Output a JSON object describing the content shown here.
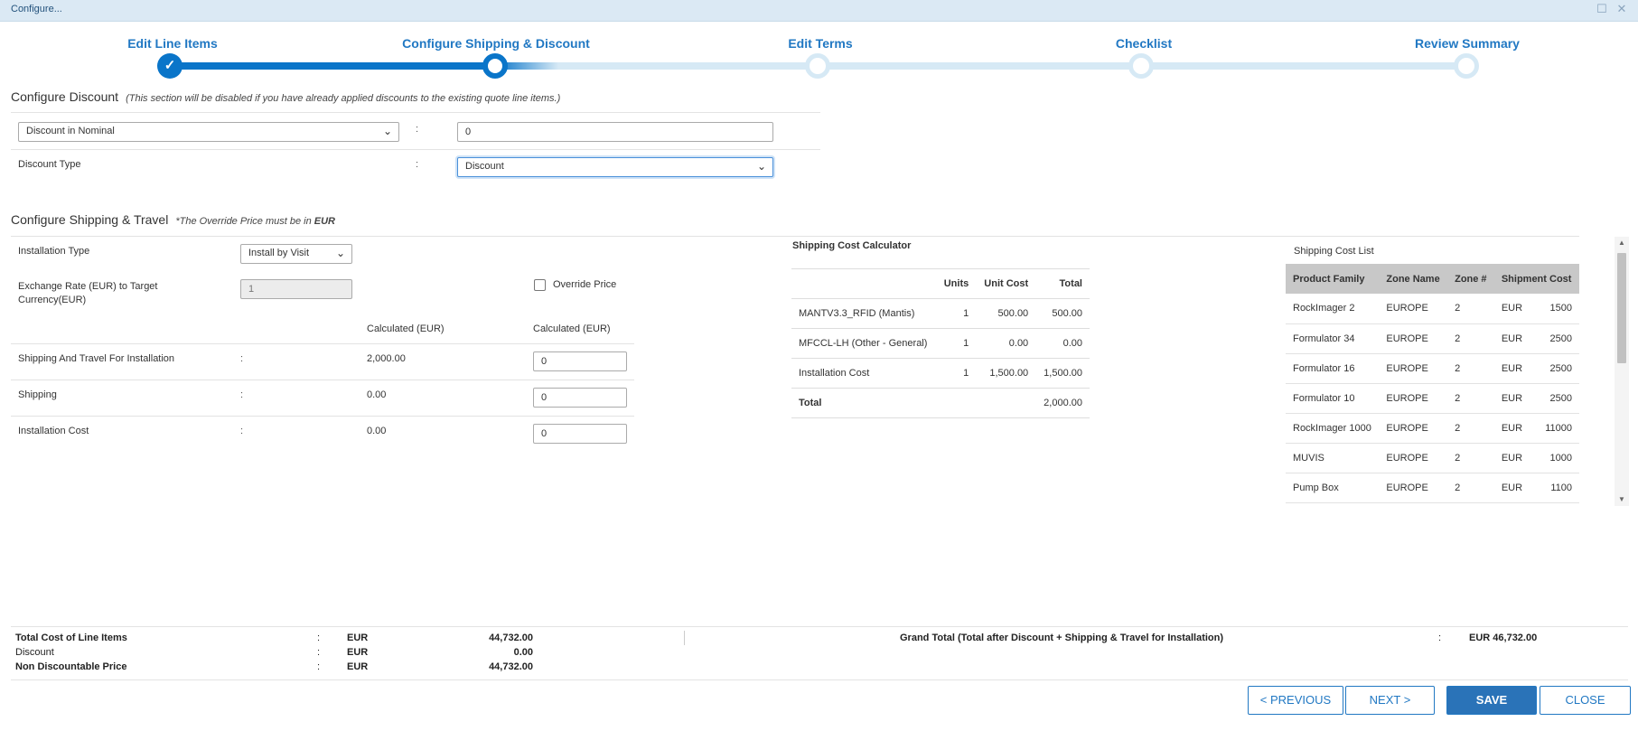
{
  "window": {
    "title": "Configure..."
  },
  "steps": [
    "Edit Line Items",
    "Configure Shipping & Discount",
    "Edit Terms",
    "Checklist",
    "Review Summary"
  ],
  "discount": {
    "title": "Configure Discount",
    "note": "(This section will be disabled if you have already applied discounts to the existing quote line items.)",
    "mode_value": "Discount in Nominal",
    "amount_value": "0",
    "type_label": "Discount Type",
    "type_value": "Discount"
  },
  "shipping": {
    "title": "Configure Shipping & Travel",
    "note_prefix": "*The Override Price must be in ",
    "note_currency": "EUR",
    "install_type_label": "Installation Type",
    "install_type_value": "Install by Visit",
    "exchange_label": "Exchange Rate (EUR) to Target Currency(EUR)",
    "exchange_value": "1",
    "override_label": "Override Price",
    "col1": "Calculated (EUR)",
    "col2": "Calculated (EUR)",
    "rows": [
      {
        "label": "Shipping And Travel For Installation",
        "calc": "2,000.00",
        "override": "0"
      },
      {
        "label": "Shipping",
        "calc": "0.00",
        "override": "0"
      },
      {
        "label": "Installation Cost",
        "calc": "0.00",
        "override": "0"
      }
    ]
  },
  "calculator": {
    "title": "Shipping Cost Calculator",
    "headers": [
      "Units",
      "Unit Cost",
      "Total"
    ],
    "rows": [
      {
        "name": "MANTV3.3_RFID (Mantis)",
        "units": "1",
        "unit_cost": "500.00",
        "total": "500.00"
      },
      {
        "name": "MFCCL-LH (Other - General)",
        "units": "1",
        "unit_cost": "0.00",
        "total": "0.00"
      },
      {
        "name": "Installation Cost",
        "units": "1",
        "unit_cost": "1,500.00",
        "total": "1,500.00"
      }
    ],
    "total_label": "Total",
    "total_value": "2,000.00"
  },
  "cost_list": {
    "title": "Shipping Cost List",
    "headers": [
      "Product Family",
      "Zone Name",
      "Zone #",
      "Shipment Cost"
    ],
    "rows": [
      {
        "family": "RockImager 2",
        "zone": "EUROPE",
        "num": "2",
        "cur": "EUR",
        "cost": "1500"
      },
      {
        "family": "Formulator 34",
        "zone": "EUROPE",
        "num": "2",
        "cur": "EUR",
        "cost": "2500"
      },
      {
        "family": "Formulator 16",
        "zone": "EUROPE",
        "num": "2",
        "cur": "EUR",
        "cost": "2500"
      },
      {
        "family": "Formulator 10",
        "zone": "EUROPE",
        "num": "2",
        "cur": "EUR",
        "cost": "2500"
      },
      {
        "family": "RockImager 1000",
        "zone": "EUROPE",
        "num": "2",
        "cur": "EUR",
        "cost": "11000"
      },
      {
        "family": "MUVIS",
        "zone": "EUROPE",
        "num": "2",
        "cur": "EUR",
        "cost": "1000"
      },
      {
        "family": "Pump Box",
        "zone": "EUROPE",
        "num": "2",
        "cur": "EUR",
        "cost": "1100"
      }
    ]
  },
  "summary": {
    "total_label": "Total Cost of Line Items",
    "total_cur": "EUR",
    "total_value": "44,732.00",
    "discount_label": "Discount",
    "discount_cur": "EUR",
    "discount_value": "0.00",
    "nondisc_label": "Non Discountable Price",
    "nondisc_cur": "EUR",
    "nondisc_value": "44,732.00",
    "grand_label": "Grand Total (Total after Discount + Shipping & Travel for Installation)",
    "grand_value": "EUR 46,732.00"
  },
  "buttons": {
    "previous": "< PREVIOUS",
    "next": "NEXT >",
    "save": "SAVE",
    "close": "CLOSE"
  },
  "colors": {
    "accent": "#0a75c9",
    "track_pending": "#d6e9f5",
    "header_bg": "#dbe9f4"
  }
}
